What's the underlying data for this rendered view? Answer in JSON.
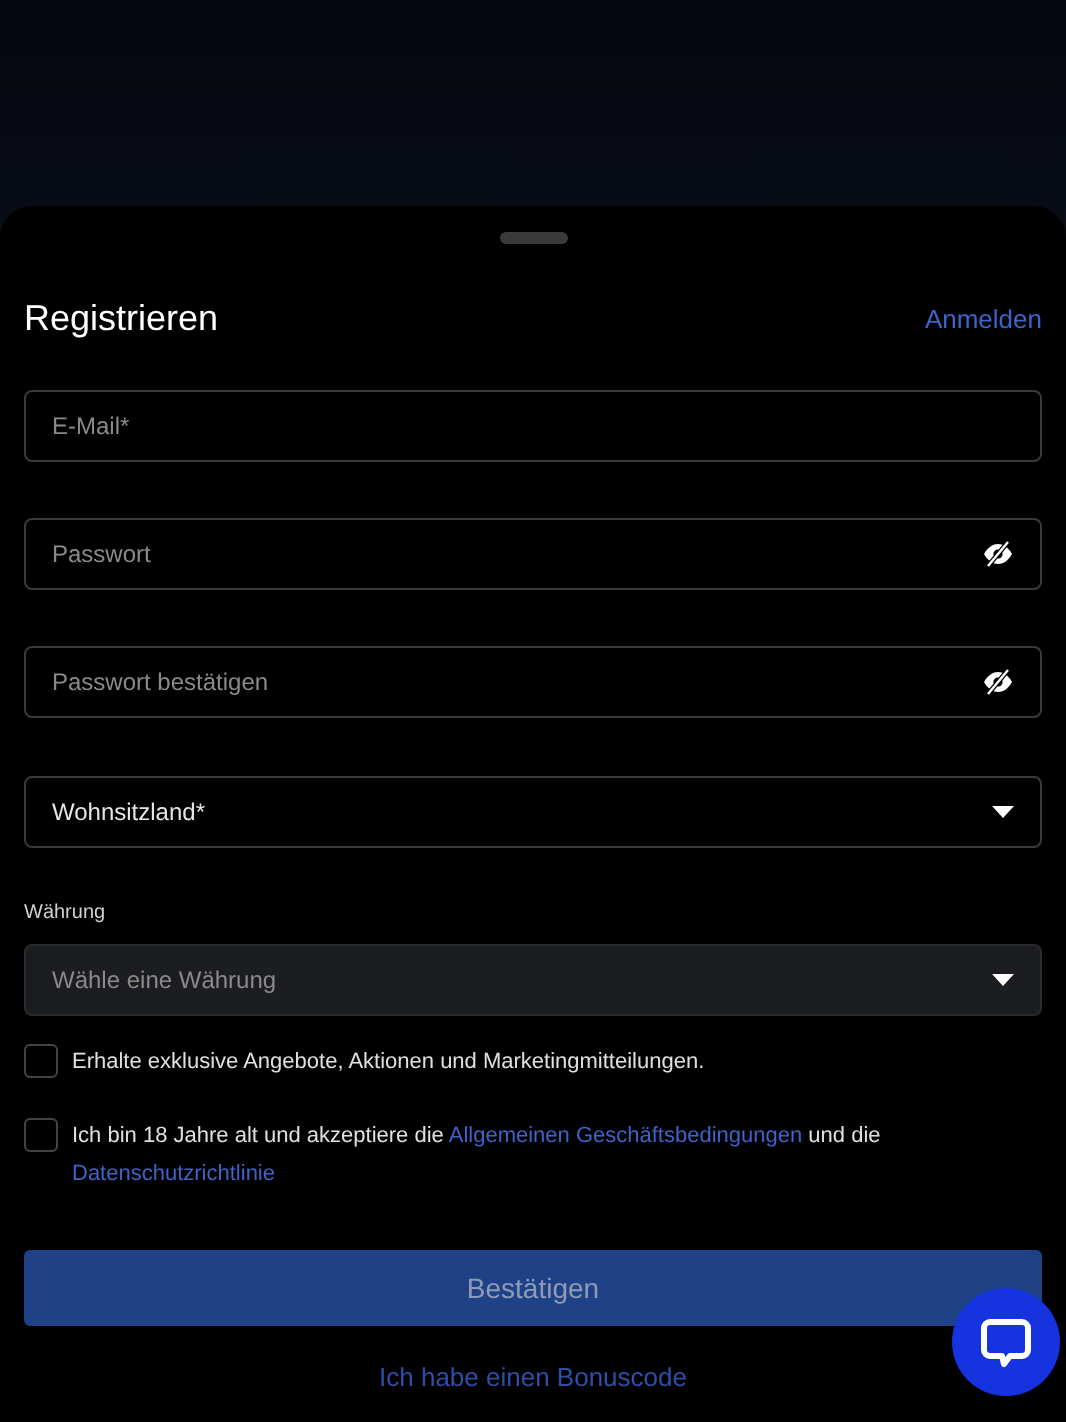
{
  "sheet": {
    "title": "Registrieren",
    "login_link": "Anmelden"
  },
  "fields": [
    {
      "kind": "text",
      "placeholder": "E-Mail*"
    },
    {
      "kind": "password",
      "placeholder": "Passwort"
    },
    {
      "kind": "password",
      "placeholder": "Passwort bestätigen"
    },
    {
      "kind": "select",
      "value": "Wohnsitzland*"
    },
    {
      "kind": "select",
      "label": "Währung",
      "placeholder": "Wähle eine Währung"
    }
  ],
  "consents": [
    {
      "checked": false,
      "parts": [
        {
          "text": "Erhalte exklusive Angebote, Aktionen und Marketingmitteilungen.",
          "link": false
        }
      ]
    },
    {
      "checked": false,
      "parts": [
        {
          "text": "Ich bin 18 Jahre alt und akzeptiere die ",
          "link": false
        },
        {
          "text": "Allgemeinen Geschäftsbedingungen",
          "link": true
        },
        {
          "text": " und die ",
          "link": false
        },
        {
          "text": "Datenschutzrichtlinie",
          "link": true
        }
      ]
    }
  ],
  "submit": {
    "label": "Bestätigen",
    "disabled": true
  },
  "bonus_link": "Ich habe einen Bonuscode"
}
